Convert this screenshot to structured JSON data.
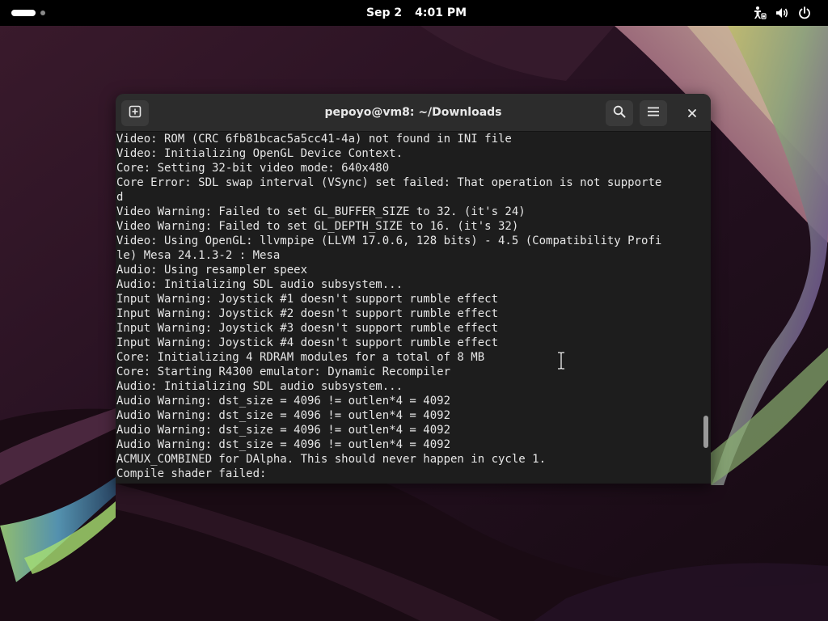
{
  "topbar": {
    "date": "Sep 2",
    "time": "4:01 PM",
    "tray_icons": [
      "accessibility-icon",
      "volume-icon",
      "power-icon"
    ]
  },
  "terminal": {
    "title": "pepoyo@vm8: ~/Downloads",
    "lines": [
      "Video: ROM (CRC 6fb81bcac5a5cc41-4a) not found in INI file",
      "Video: Initializing OpenGL Device Context.",
      "Core: Setting 32-bit video mode: 640x480",
      "Core Error: SDL swap interval (VSync) set failed: That operation is not supporte",
      "d",
      "Video Warning: Failed to set GL_BUFFER_SIZE to 32. (it's 24)",
      "Video Warning: Failed to set GL_DEPTH_SIZE to 16. (it's 32)",
      "Video: Using OpenGL: llvmpipe (LLVM 17.0.6, 128 bits) - 4.5 (Compatibility Profi",
      "le) Mesa 24.1.3-2 : Mesa",
      "Audio: Using resampler speex",
      "Audio: Initializing SDL audio subsystem...",
      "Input Warning: Joystick #1 doesn't support rumble effect",
      "Input Warning: Joystick #2 doesn't support rumble effect",
      "Input Warning: Joystick #3 doesn't support rumble effect",
      "Input Warning: Joystick #4 doesn't support rumble effect",
      "Core: Initializing 4 RDRAM modules for a total of 8 MB",
      "Core: Starting R4300 emulator: Dynamic Recompiler",
      "Audio: Initializing SDL audio subsystem...",
      "Audio Warning: dst_size = 4096 != outlen*4 = 4092",
      "Audio Warning: dst_size = 4096 != outlen*4 = 4092",
      "Audio Warning: dst_size = 4096 != outlen*4 = 4092",
      "Audio Warning: dst_size = 4096 != outlen*4 = 4092",
      "ACMUX_COMBINED for DAlpha. This should never happen in cycle 1.",
      "Compile shader failed:"
    ]
  },
  "colors": {
    "topbar_bg": "#000000",
    "terminal_bg": "#1d1d1d",
    "headerbar_bg": "#2c2c2c",
    "terminal_text": "#e6e6e6"
  }
}
